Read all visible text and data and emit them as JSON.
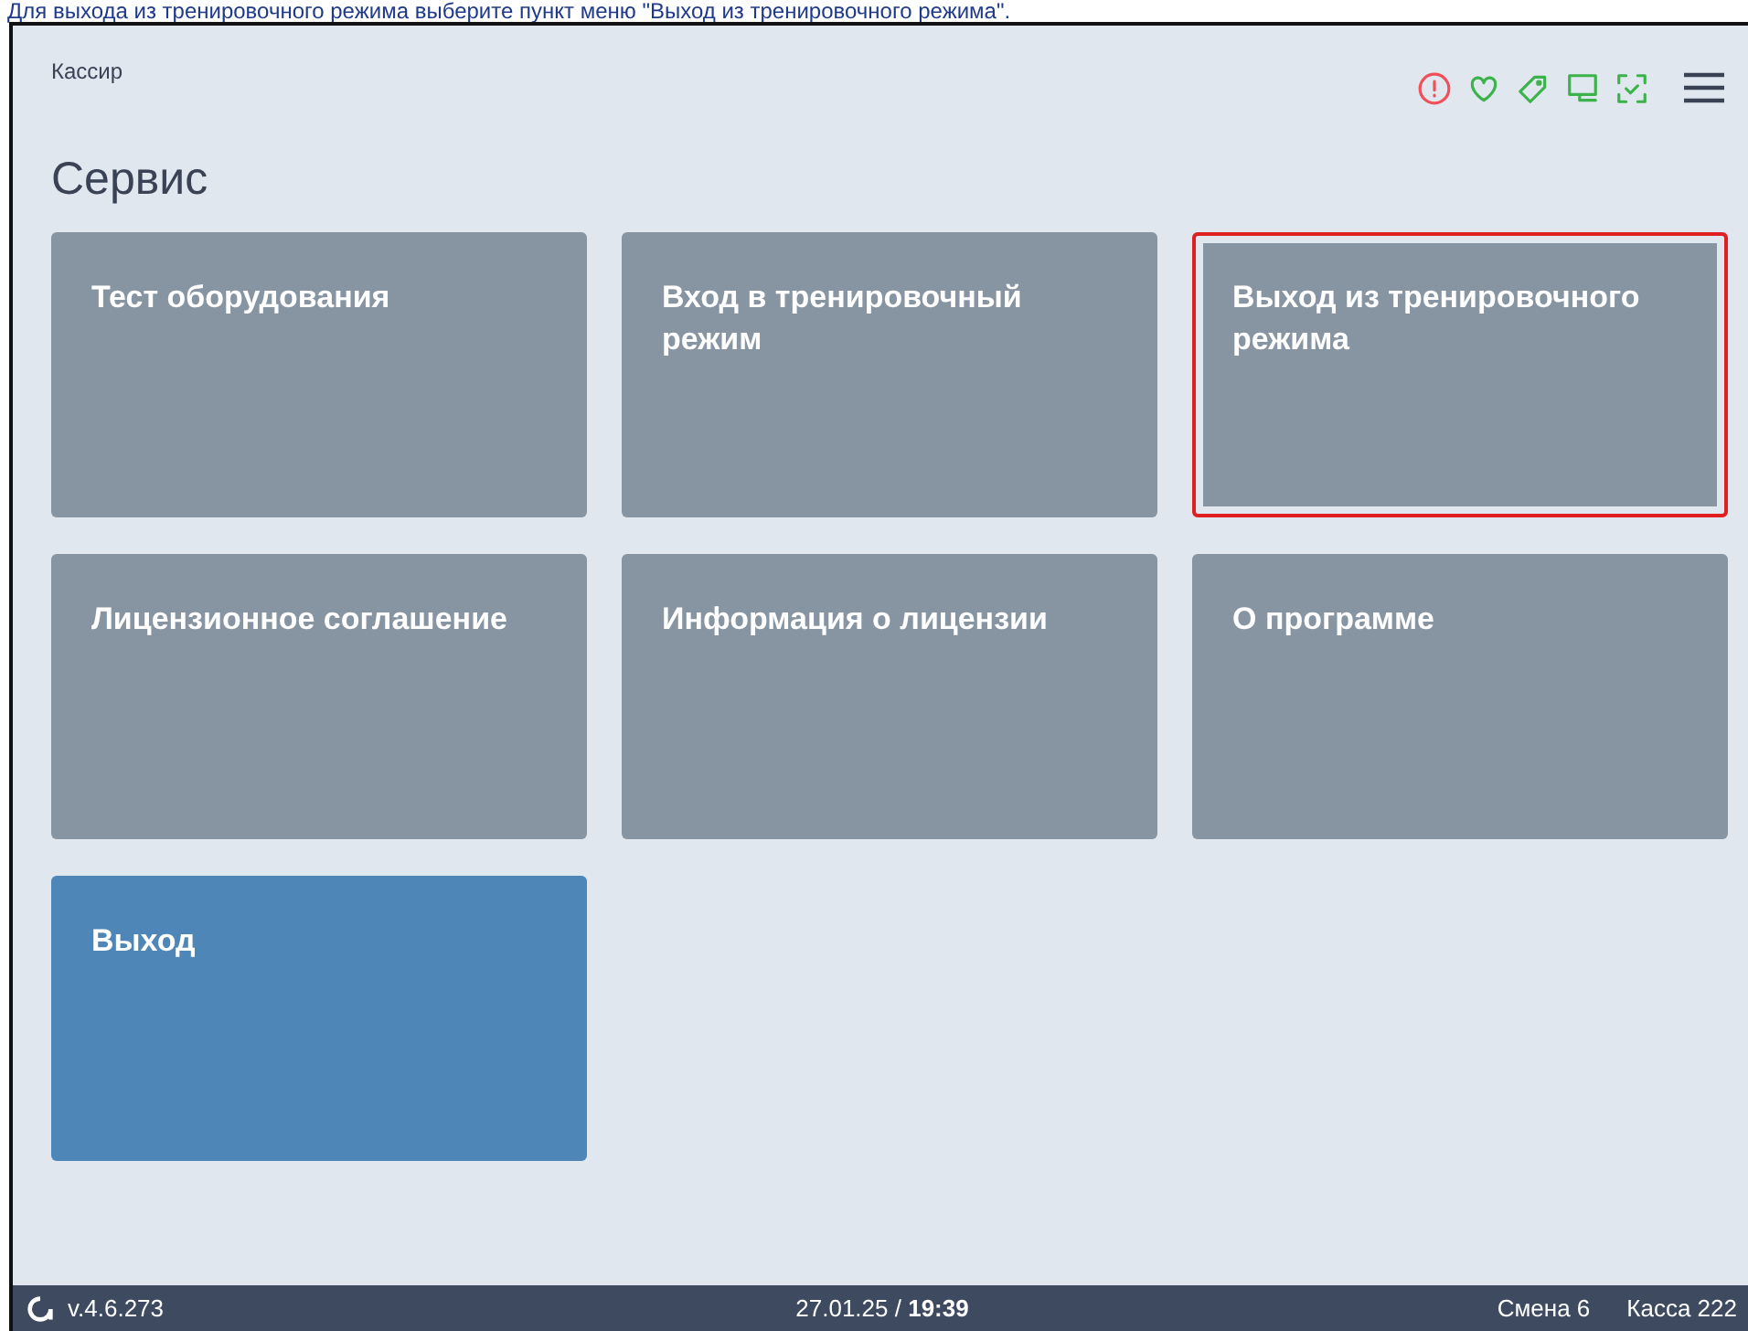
{
  "caption": "Для выхода из тренировочного режима выберите пункт меню \"Выход из тренировочного режима\".",
  "header": {
    "user": "Кассир",
    "status_icons": [
      {
        "kind": "alert",
        "color": "#f0505a"
      },
      {
        "kind": "heart",
        "color": "#3bb34a"
      },
      {
        "kind": "tag",
        "color": "#3bb34a"
      },
      {
        "kind": "monitor",
        "color": "#3bb34a"
      },
      {
        "kind": "scan",
        "color": "#3bb34a"
      }
    ]
  },
  "title": "Сервис",
  "tiles": [
    {
      "label": "Тест оборудования",
      "kind": "normal",
      "highlighted": false
    },
    {
      "label": "Вход в тренировочный режим",
      "kind": "normal",
      "highlighted": false
    },
    {
      "label": "Выход из тренировочного режима",
      "kind": "normal",
      "highlighted": true
    },
    {
      "label": "Лицензионное соглашение",
      "kind": "normal",
      "highlighted": false
    },
    {
      "label": "Информация о лицензии",
      "kind": "normal",
      "highlighted": false
    },
    {
      "label": "О программе",
      "kind": "normal",
      "highlighted": false
    },
    {
      "label": "Выход",
      "kind": "primary",
      "highlighted": false
    }
  ],
  "status_bar": {
    "version": "v.4.6.273",
    "date": "27.01.25",
    "separator": "/",
    "time": "19:39",
    "shift": "Смена 6",
    "register": "Касса 222"
  }
}
